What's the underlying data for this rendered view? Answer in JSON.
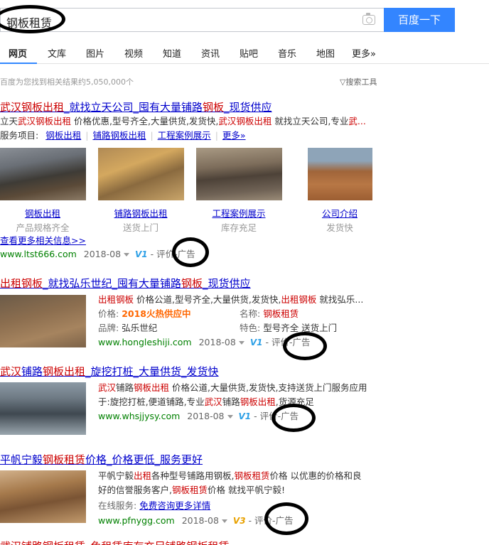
{
  "search": {
    "query": "钢板租赁",
    "button": "百度一下"
  },
  "tabs": [
    "网页",
    "文库",
    "图片",
    "视频",
    "知道",
    "资讯",
    "贴吧",
    "音乐",
    "地图",
    "更多»"
  ],
  "stats": "百度为您找到相关结果约5,050,000个",
  "tools": "搜索工具",
  "results": [
    {
      "title_parts": [
        "武汉钢板出租",
        "_就找立天公司_囤有大量铺路",
        "钢板",
        "_现货供应"
      ],
      "desc_parts": [
        "立天",
        "武汉钢板出租",
        " 价格优惠,型号齐全,大量供货,发货快,",
        "武汉钢板出租",
        " 就找立天公司,专业",
        "武..."
      ],
      "services_label": "服务项目:",
      "services": [
        "钢板出租",
        "铺路钢板出租",
        "工程案例展示",
        "更多»"
      ],
      "thumbs": [
        {
          "link": "钢板出租",
          "sub": "产品规格齐全"
        },
        {
          "link": "铺路钢板出租",
          "sub": "送货上门"
        },
        {
          "link": "工程案例展示",
          "sub": "库存充足"
        },
        {
          "link": "公司介绍",
          "sub": "发货快"
        }
      ],
      "more": "查看更多相关信息>>",
      "url": "www.ltst666.com",
      "date": "2018-08",
      "badge": "V1",
      "eval": "评价",
      "ad": "广告"
    },
    {
      "title_parts": [
        "出租钢板",
        "_就找弘乐世纪_囤有大量铺路",
        "钢板",
        "_现货供应"
      ],
      "desc_parts": [
        "出租钢板",
        " 价格公道,型号齐全,大量供货,发货快,",
        "出租钢板",
        " 就找弘乐..."
      ],
      "price_label": "价格:",
      "price_value": "2018火热供应中",
      "name_label": "名称:",
      "name_value": "钢板租赁",
      "brand_label": "品牌:",
      "brand_value": "弘乐世纪",
      "feature_label": "特色:",
      "feature_value": "型号齐全 送货上门",
      "url": "www.hongleshiji.com",
      "date": "2018-08",
      "badge": "V1",
      "eval": "评价",
      "ad": "广告"
    },
    {
      "title_parts": [
        "武汉",
        "铺路",
        "钢板出租",
        "_旋挖打桩_大量供货_发货快"
      ],
      "desc_line1_parts": [
        "武汉",
        "铺路",
        "钢板出租",
        " 价格公道,大量供货,发货快,支持送货上门服务应用"
      ],
      "desc_line2_parts": [
        "于:旋挖打桩,便道铺路,专业",
        "武汉",
        "铺路",
        "钢板出租",
        ",货源充足"
      ],
      "url": "www.whsjjysy.com",
      "date": "2018-08",
      "badge": "V1",
      "eval": "评价",
      "ad": "广告"
    },
    {
      "title_parts": [
        "平帆宁毅",
        "钢板租赁",
        "价格_价格更低_服务更好"
      ],
      "desc_line1_parts": [
        "平帆宁毅",
        "出租",
        "各种型号铺路用钢板,",
        "钢板租赁",
        "价格 以优惠的价格和良"
      ],
      "desc_line2_parts": [
        "好的信誉服务客户,",
        "钢板租赁",
        "价格 就找平帆宁毅!"
      ],
      "online_label": "在线服务:",
      "online_link": "免费咨询更多详情",
      "url": "www.pfnygg.com",
      "date": "2018-08",
      "badge": "V3",
      "eval": "评价",
      "ad": "广告"
    }
  ],
  "partial_next": "武汉铺路钢板租赁_免租赁库存充足铺路钢板租赁"
}
